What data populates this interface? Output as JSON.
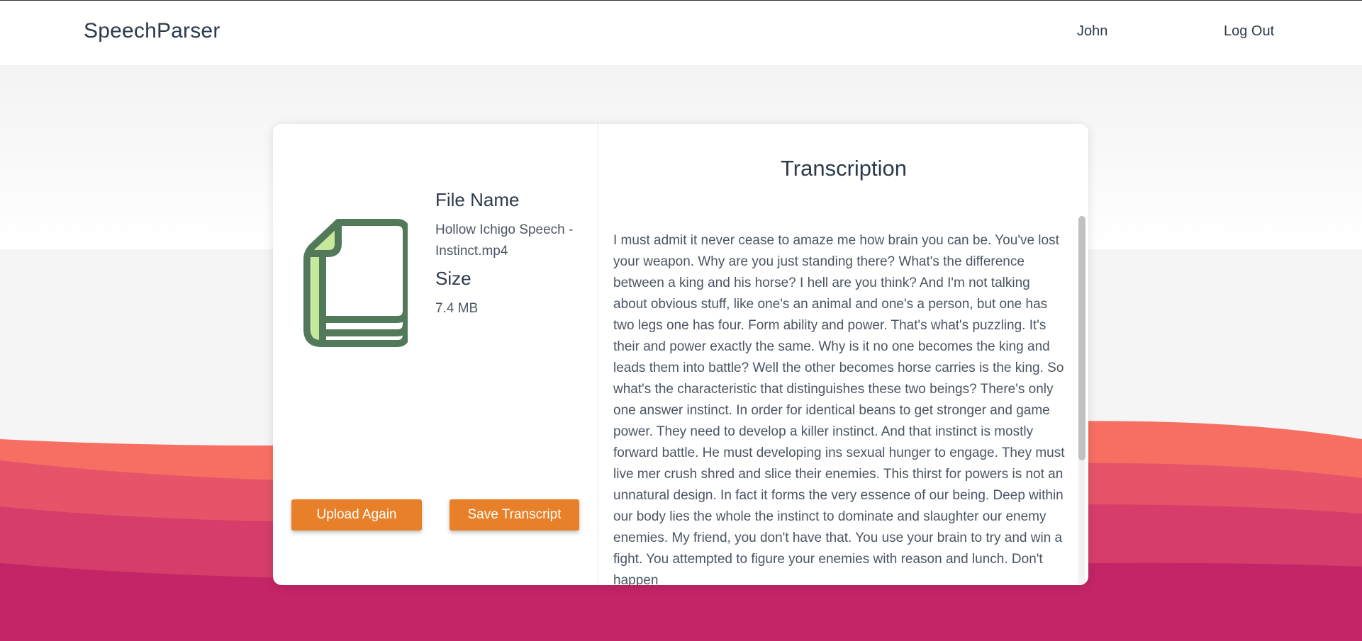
{
  "navbar": {
    "brand": "SpeechParser",
    "user": "John",
    "logout": "Log Out"
  },
  "file": {
    "name_heading": "File Name",
    "name_value": "Hollow Ichigo Speech - Instinct.mp4",
    "size_heading": "Size",
    "size_value": "7.4 MB",
    "icon": "document-icon"
  },
  "actions": {
    "upload_again": "Upload Again",
    "save_transcript": "Save Transcript"
  },
  "transcription": {
    "title": "Transcription",
    "text": "I must admit it never cease to amaze me how brain you can be. You've lost your weapon. Why are you just standing there? What's the difference between a king and his horse? I hell are you think? And I'm not talking about obvious stuff, like one's an animal and one's a person, but one has two legs one has four. Form ability and power. That's what's puzzling. It's their and power exactly the same. Why is it no one becomes the king and leads them into battle? Well the other becomes horse carries is the king. So what's the characteristic that distinguishes these two beings? There's only one answer instinct. In order for identical beans to get stronger and game power. They need to develop a killer instinct. And that instinct is mostly forward battle. He must developing ins sexual hunger to engage. They must live mer crush shred and slice their enemies. This thirst for powers is not an unnatural design. In fact it forms the very essence of our being. Deep within our body lies the whole the instinct to dominate and slaughter our enemy enemies. My friend, you don't have that. You use your brain to try and win a fight. You attempted to figure your enemies with reason and lunch. Don't happen"
  },
  "colors": {
    "accent": "#e8802a",
    "icon_stroke": "#527a5a",
    "icon_fill": "#c6e89a",
    "wave_1": "#f76f62",
    "wave_2": "#e55468",
    "wave_3": "#d63d6a",
    "wave_4": "#c42566"
  }
}
